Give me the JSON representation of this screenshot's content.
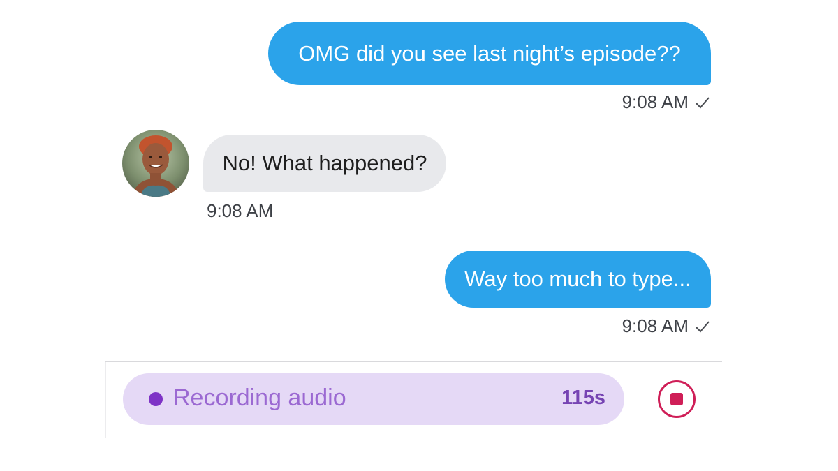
{
  "conversation": {
    "messages": [
      {
        "direction": "outgoing",
        "text": "OMG did you see last night’s episode??",
        "time": "9:08 AM",
        "status_icon": "checkmark-icon"
      },
      {
        "direction": "incoming",
        "text": "No! What happened?",
        "time": "9:08 AM",
        "sender_avatar": "contact-avatar"
      },
      {
        "direction": "outgoing",
        "text": "Way too much to type...",
        "time": "9:08 AM",
        "status_icon": "checkmark-icon"
      }
    ]
  },
  "recorder": {
    "label": "Recording audio",
    "counter": "115s",
    "indicator_icon": "recording-dot-icon",
    "stop_icon": "stop-record-icon"
  },
  "colors": {
    "outgoing_bubble": "#2ba3ea",
    "incoming_bubble": "#e8e9ec",
    "recorder_pill": "#e5d9f6",
    "recorder_accent": "#7e33c6",
    "stop_button": "#cf1e57"
  }
}
